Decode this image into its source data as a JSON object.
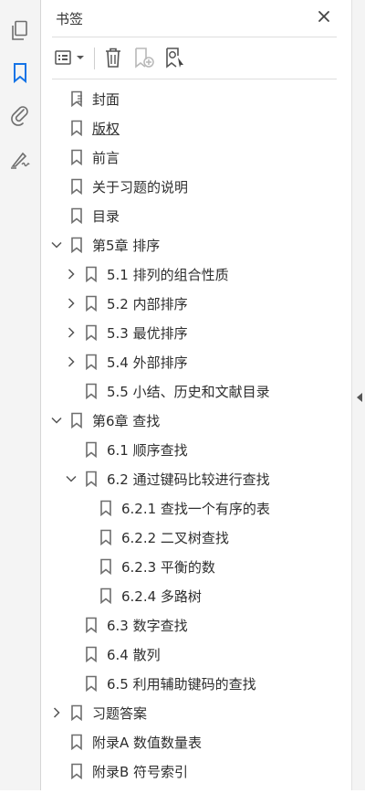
{
  "panel": {
    "title": "书签"
  },
  "colors": {
    "accent": "#1473e6",
    "bookmark": "#6e6e6e",
    "text": "#2e2e2e"
  },
  "rail": {
    "items": [
      {
        "icon": "pages-icon"
      },
      {
        "icon": "bookmark-icon",
        "active": true
      },
      {
        "icon": "attachment-icon"
      },
      {
        "icon": "signature-icon"
      }
    ]
  },
  "toolbar": {
    "items": [
      {
        "icon": "options-menu-icon"
      },
      {
        "icon": "delete-icon"
      },
      {
        "icon": "new-bookmark-icon",
        "disabled": true
      },
      {
        "icon": "find-bookmark-icon"
      }
    ]
  },
  "bookmarks": [
    {
      "label": "封面",
      "level": 0,
      "toggle": "none",
      "icon": "page-bookmark"
    },
    {
      "label": "版权",
      "level": 0,
      "toggle": "none",
      "underline": true
    },
    {
      "label": "前言",
      "level": 0,
      "toggle": "none"
    },
    {
      "label": "关于习题的说明",
      "level": 0,
      "toggle": "none"
    },
    {
      "label": "目录",
      "level": 0,
      "toggle": "none"
    },
    {
      "label": "第5章 排序",
      "level": 0,
      "toggle": "expanded"
    },
    {
      "label": "5.1 排列的组合性质",
      "level": 1,
      "toggle": "collapsed"
    },
    {
      "label": "5.2 内部排序",
      "level": 1,
      "toggle": "collapsed"
    },
    {
      "label": "5.3 最优排序",
      "level": 1,
      "toggle": "collapsed"
    },
    {
      "label": "5.4 外部排序",
      "level": 1,
      "toggle": "collapsed"
    },
    {
      "label": "5.5 小结、历史和文献目录",
      "level": 1,
      "toggle": "none"
    },
    {
      "label": "第6章 查找",
      "level": 0,
      "toggle": "expanded"
    },
    {
      "label": "6.1 顺序查找",
      "level": 1,
      "toggle": "none"
    },
    {
      "label": "6.2 通过键码比较进行查找",
      "level": 1,
      "toggle": "expanded"
    },
    {
      "label": "6.2.1 查找一个有序的表",
      "level": 2,
      "toggle": "none"
    },
    {
      "label": "6.2.2 二叉树查找",
      "level": 2,
      "toggle": "none"
    },
    {
      "label": "6.2.3 平衡的数",
      "level": 2,
      "toggle": "none"
    },
    {
      "label": "6.2.4 多路树",
      "level": 2,
      "toggle": "none"
    },
    {
      "label": "6.3 数字查找",
      "level": 1,
      "toggle": "none"
    },
    {
      "label": "6.4 散列",
      "level": 1,
      "toggle": "none"
    },
    {
      "label": "6.5 利用辅助键码的查找",
      "level": 1,
      "toggle": "none"
    },
    {
      "label": "习题答案",
      "level": 0,
      "toggle": "collapsed"
    },
    {
      "label": "附录A 数值数量表",
      "level": 0,
      "toggle": "none"
    },
    {
      "label": "附录B 符号索引",
      "level": 0,
      "toggle": "none"
    }
  ]
}
